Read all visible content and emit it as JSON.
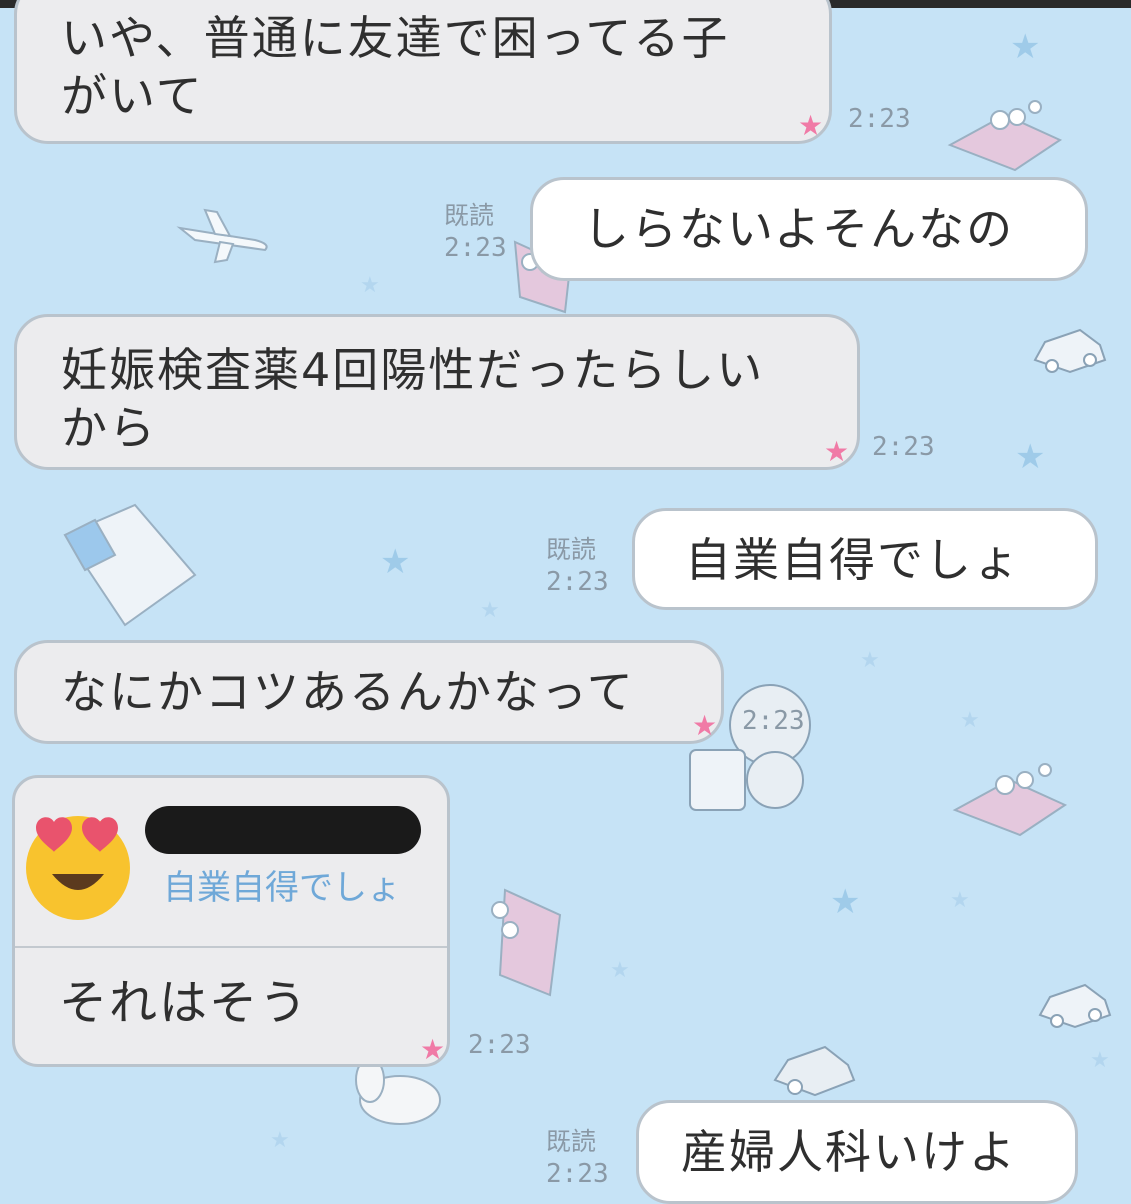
{
  "messages": [
    {
      "id": "m1",
      "side": "in",
      "lines": [
        "いや、普通に友達で困ってる子",
        "がいて"
      ],
      "time": "2:23"
    },
    {
      "id": "m2",
      "side": "out",
      "lines": [
        "しらないよそんなの"
      ],
      "time": "2:23",
      "read": "既読"
    },
    {
      "id": "m3",
      "side": "in",
      "lines": [
        "妊娠検査薬4回陽性だったらしい",
        "から"
      ],
      "time": "2:23"
    },
    {
      "id": "m4",
      "side": "out",
      "lines": [
        "自業自得でしょ"
      ],
      "time": "2:23",
      "read": "既読"
    },
    {
      "id": "m5",
      "side": "in",
      "lines": [
        "なにかコツあるんかなって"
      ],
      "time": "2:23"
    },
    {
      "id": "m6",
      "side": "out",
      "lines": [
        "産婦人科いけよ"
      ],
      "time": "2:23",
      "read": "既読"
    }
  ],
  "reply": {
    "quoted_text": "自業自得でしょ",
    "text": "それはそう",
    "time": "2:23",
    "emoji": "heart-eyes-emoji"
  },
  "colors": {
    "background": "#c6e3f6",
    "incoming_bubble": "#ececee",
    "outgoing_bubble": "#ffffff",
    "quoted_text": "#6fa8d8",
    "star_pink": "#f07aa6",
    "star_lavender": "#a99ae6"
  }
}
